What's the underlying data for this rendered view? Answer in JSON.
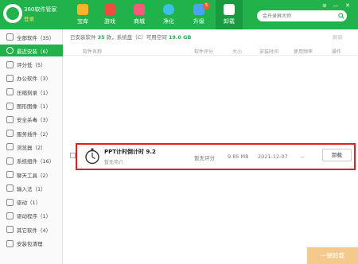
{
  "header": {
    "app_title": "360软件管家",
    "login": "登录",
    "tabs": [
      {
        "label": "宝库",
        "color": "#f7b52c"
      },
      {
        "label": "游戏",
        "color": "#e94e3f"
      },
      {
        "label": "商城",
        "color": "#f25c7a"
      },
      {
        "label": "净化",
        "color": "#3cc0e6"
      },
      {
        "label": "升级",
        "color": "#4aa3f0",
        "badge": "5"
      },
      {
        "label": "卸载",
        "color": "#ffffff",
        "active": true
      }
    ],
    "search_placeholder": "金舟录屏大师",
    "window_controls": [
      "≡",
      "—",
      "✕"
    ]
  },
  "sidebar": {
    "items": [
      {
        "label": "全部软件（35）",
        "active": false
      },
      {
        "label": "最近安装（6）",
        "active": true
      },
      {
        "label": "评分低（5）",
        "active": false
      },
      {
        "label": "办公软件（3）",
        "active": false
      },
      {
        "label": "压缩刻录（1）",
        "active": false
      },
      {
        "label": "图形图像（1）",
        "active": false
      },
      {
        "label": "安全杀毒（3）",
        "active": false
      },
      {
        "label": "服务插件（2）",
        "active": false
      },
      {
        "label": "浏览器（2）",
        "active": false
      },
      {
        "label": "系统组件（16）",
        "active": false
      },
      {
        "label": "聊天工具（2）",
        "active": false
      },
      {
        "label": "输入法（1）",
        "active": false
      },
      {
        "label": "驱动（1）",
        "active": false
      },
      {
        "label": "驱动程序（1）",
        "active": false
      },
      {
        "label": "其它软件（4）",
        "active": false
      },
      {
        "label": "安装包清理",
        "active": false
      }
    ]
  },
  "main": {
    "info_prefix": "已安装软件",
    "info_count": "35",
    "info_mid": "款，系统盘（C）可用空间",
    "info_space": "19.0 GB",
    "refresh": "刷新",
    "columns": [
      "软件名称",
      "软件评分",
      "大小",
      "安装时间",
      "使用频率",
      "操作"
    ],
    "row": {
      "name": "PPT计时倒计时 9.2",
      "desc": "暂无简介",
      "score": "暂无评分",
      "size": "9.85 MB",
      "date": "2021-12-07",
      "freq": "--",
      "action": "卸载"
    },
    "bulk_uninstall": "一键卸载"
  }
}
